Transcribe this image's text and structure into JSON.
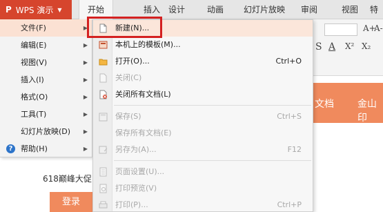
{
  "app": {
    "logo": "P",
    "name": "WPS 演示"
  },
  "tabs": [
    "开始",
    "插入",
    "设计",
    "动画",
    "幻灯片放映",
    "审阅",
    "视图",
    "特"
  ],
  "ribbon": {
    "glyphs": [
      "A+",
      "A-",
      "S",
      "A",
      "X²",
      "X₂"
    ]
  },
  "doc": {
    "band_text_1": "文档",
    "band_text_2": "金山印",
    "promo": "618巅峰大促",
    "promo_button": "登录"
  },
  "app_menu": [
    {
      "label": "文件(F)"
    },
    {
      "label": "编辑(E)"
    },
    {
      "label": "视图(V)"
    },
    {
      "label": "插入(I)"
    },
    {
      "label": "格式(O)"
    },
    {
      "label": "工具(T)"
    },
    {
      "label": "幻灯片放映(D)"
    },
    {
      "label": "帮助(H)"
    }
  ],
  "file_menu": [
    {
      "label": "新建(N)...",
      "shortcut": ""
    },
    {
      "label": "本机上的模板(M)...",
      "shortcut": ""
    },
    {
      "label": "打开(O)...",
      "shortcut": "Ctrl+O"
    },
    {
      "label": "关闭(C)",
      "shortcut": ""
    },
    {
      "label": "关闭所有文档(L)",
      "shortcut": ""
    },
    {
      "label": "保存(S)",
      "shortcut": "Ctrl+S"
    },
    {
      "label": "保存所有文档(E)",
      "shortcut": ""
    },
    {
      "label": "另存为(A)...",
      "shortcut": "F12"
    },
    {
      "label": "页面设置(U)...",
      "shortcut": ""
    },
    {
      "label": "打印预览(V)",
      "shortcut": ""
    },
    {
      "label": "打印(P)...",
      "shortcut": "Ctrl+P"
    }
  ],
  "colors": {
    "accent": "#d6452d",
    "highlight": "#d42020",
    "band": "#f08a5d"
  }
}
